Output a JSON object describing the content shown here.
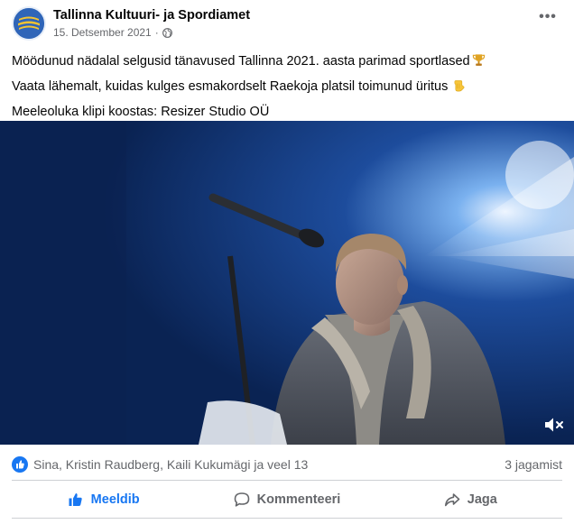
{
  "post": {
    "page_name": "Tallinna Kultuuri- ja Spordiamet",
    "date": "15. Detsember 2021",
    "separator": "·",
    "more_label": "•••",
    "text_lines": [
      "Möödunud nädalal selgusid tänavused Tallinna 2021. aasta parimad sportlased",
      "Vaata lähemalt, kuidas kulges esmakordselt Raekoja platsil toimunud üritus",
      "Meeleoluka klipi koostas: Resizer Studio OÜ"
    ],
    "line_emojis": [
      "trophy-icon",
      "pointing-hand-icon"
    ]
  },
  "video": {
    "muted": true
  },
  "engagement": {
    "reactors": "Sina, Kristin Raudberg, Kaili Kukumägi ja veel 13",
    "shares": "3 jagamist"
  },
  "actions": {
    "like_label": "Meeldib",
    "comment_label": "Kommenteeri",
    "share_label": "Jaga"
  },
  "colors": {
    "brand_blue": "#1877f2",
    "muted_text": "#65676b"
  }
}
